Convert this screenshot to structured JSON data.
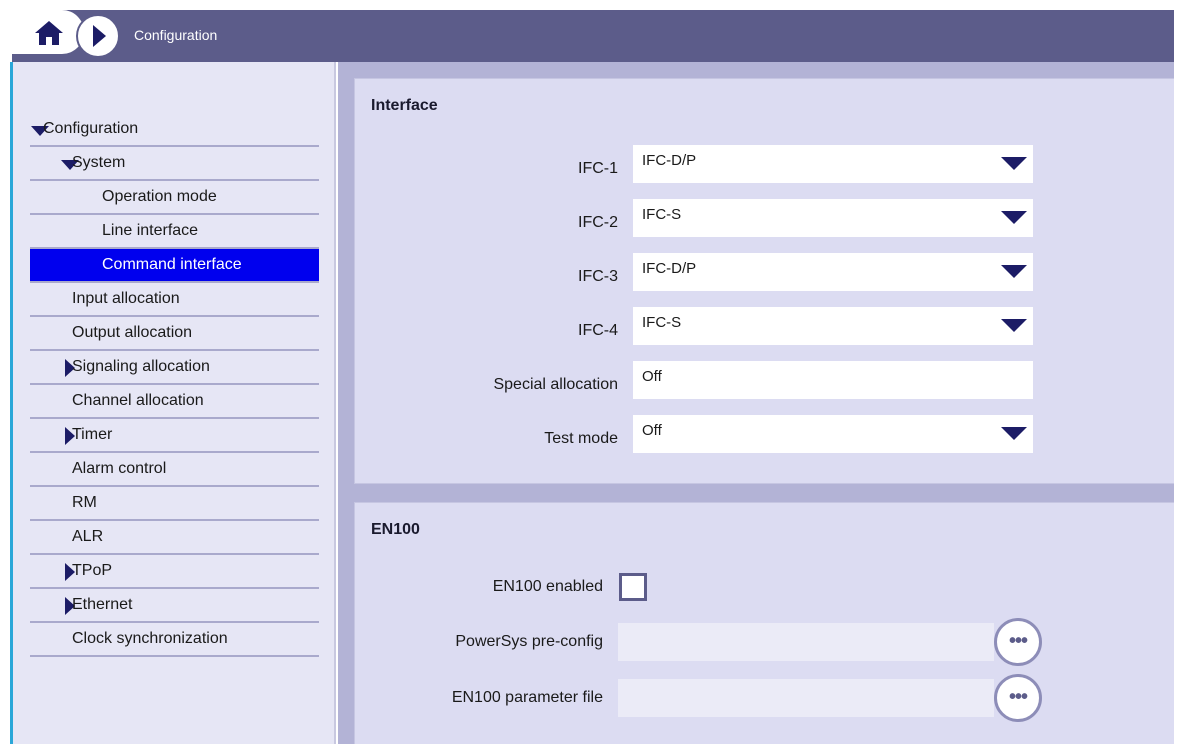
{
  "topbar": {
    "title": "Configuration",
    "home_icon": "home-icon",
    "forward_icon": "play-icon"
  },
  "sidebar": {
    "items": [
      {
        "label": "Configuration",
        "level": 0,
        "expander": "expanded"
      },
      {
        "label": "System",
        "level": 1,
        "expander": "expanded"
      },
      {
        "label": "Operation mode",
        "level": 2,
        "expander": "none"
      },
      {
        "label": "Line interface",
        "level": 2,
        "expander": "none"
      },
      {
        "label": "Command interface",
        "level": 2,
        "expander": "none",
        "selected": true
      },
      {
        "label": "Input allocation",
        "level": 1,
        "expander": "none"
      },
      {
        "label": "Output allocation",
        "level": 1,
        "expander": "none"
      },
      {
        "label": "Signaling allocation",
        "level": 1,
        "expander": "collapsed"
      },
      {
        "label": "Channel allocation",
        "level": 1,
        "expander": "none"
      },
      {
        "label": "Timer",
        "level": 1,
        "expander": "collapsed"
      },
      {
        "label": "Alarm control",
        "level": 1,
        "expander": "none"
      },
      {
        "label": "RM",
        "level": 1,
        "expander": "none"
      },
      {
        "label": "ALR",
        "level": 1,
        "expander": "none"
      },
      {
        "label": "TPoP",
        "level": 1,
        "expander": "collapsed"
      },
      {
        "label": "Ethernet",
        "level": 1,
        "expander": "collapsed"
      },
      {
        "label": "Clock synchronization",
        "level": 1,
        "expander": "none"
      }
    ]
  },
  "interface_panel": {
    "title": "Interface",
    "fields": [
      {
        "label": "IFC-1",
        "value": "IFC-D/P",
        "type": "select"
      },
      {
        "label": "IFC-2",
        "value": "IFC-S",
        "type": "select"
      },
      {
        "label": "IFC-3",
        "value": "IFC-D/P",
        "type": "select"
      },
      {
        "label": "IFC-4",
        "value": "IFC-S",
        "type": "select"
      },
      {
        "label": "Special allocation",
        "value": "Off",
        "type": "text"
      },
      {
        "label": "Test mode",
        "value": "Off",
        "type": "select"
      }
    ]
  },
  "en100_panel": {
    "title": "EN100",
    "enabled_label": "EN100 enabled",
    "enabled": false,
    "preconfig_label": "PowerSys pre-config",
    "preconfig_value": "",
    "param_file_label": "EN100 parameter file",
    "param_file_value": "",
    "browse_button": "•••"
  },
  "colors": {
    "topbar": "#5c5c8a",
    "selection": "#0000ee",
    "panel": "#dcdcf2",
    "accent": "#2aa7d8"
  }
}
